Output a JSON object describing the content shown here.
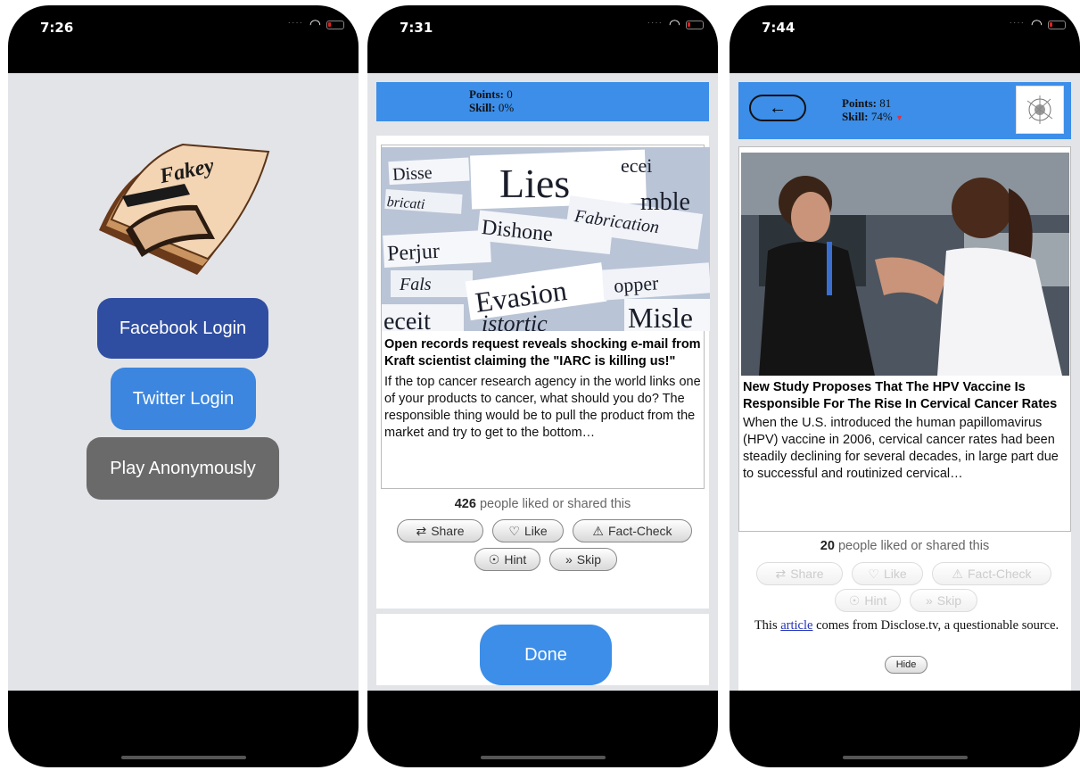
{
  "screen1": {
    "time": "7:26",
    "logo_text": "Fakey",
    "buttons": {
      "facebook": "Facebook Login",
      "twitter": "Twitter Login",
      "anonymous": "Play Anonymously"
    }
  },
  "screen2": {
    "time": "7:31",
    "points_label": "Points:",
    "points_value": "0",
    "skill_label": "Skill:",
    "skill_value": "0%",
    "image_words": [
      "Lies",
      "Dishonesty",
      "Fabrication",
      "Perjury",
      "Evasion",
      "Distortion",
      "Deceit",
      "Misleading"
    ],
    "headline": "Open records request reveals shocking e-mail from Kraft scientist claiming the \"IARC is killing us!\"",
    "description": "If the top cancer research agency in the world links one of your products to cancer, what should you do? The responsible thing would be to pull the product from the market and try to get to the bottom…",
    "likes_count": "426",
    "likes_text": "people liked or shared this",
    "actions": {
      "share": "Share",
      "like": "Like",
      "factcheck": "Fact-Check",
      "hint": "Hint",
      "skip": "Skip"
    },
    "done": "Done"
  },
  "screen3": {
    "time": "7:44",
    "points_label": "Points:",
    "points_value": "81",
    "skill_label": "Skill:",
    "skill_value": "74%",
    "headline": "New Study Proposes That The HPV Vaccine Is Responsible For The Rise In Cervical Cancer Rates",
    "description": "When the U.S. introduced the human papillomavirus (HPV) vaccine in 2006, cervical cancer rates had been steadily declining for several decades, in large part due to successful and routinized cervical…",
    "likes_count": "20",
    "likes_text": "people liked or shared this",
    "actions": {
      "share": "Share",
      "like": "Like",
      "factcheck": "Fact-Check",
      "hint": "Hint",
      "skip": "Skip"
    },
    "source_prefix": "This",
    "source_link": "article",
    "source_suffix": "comes from Disclose.tv, a questionable source.",
    "hide": "Hide"
  },
  "colors": {
    "brand_blue": "#3c8ee8",
    "facebook": "#2f4ea1",
    "twitter": "#3c86df",
    "anonymous": "#6a6a6a"
  }
}
